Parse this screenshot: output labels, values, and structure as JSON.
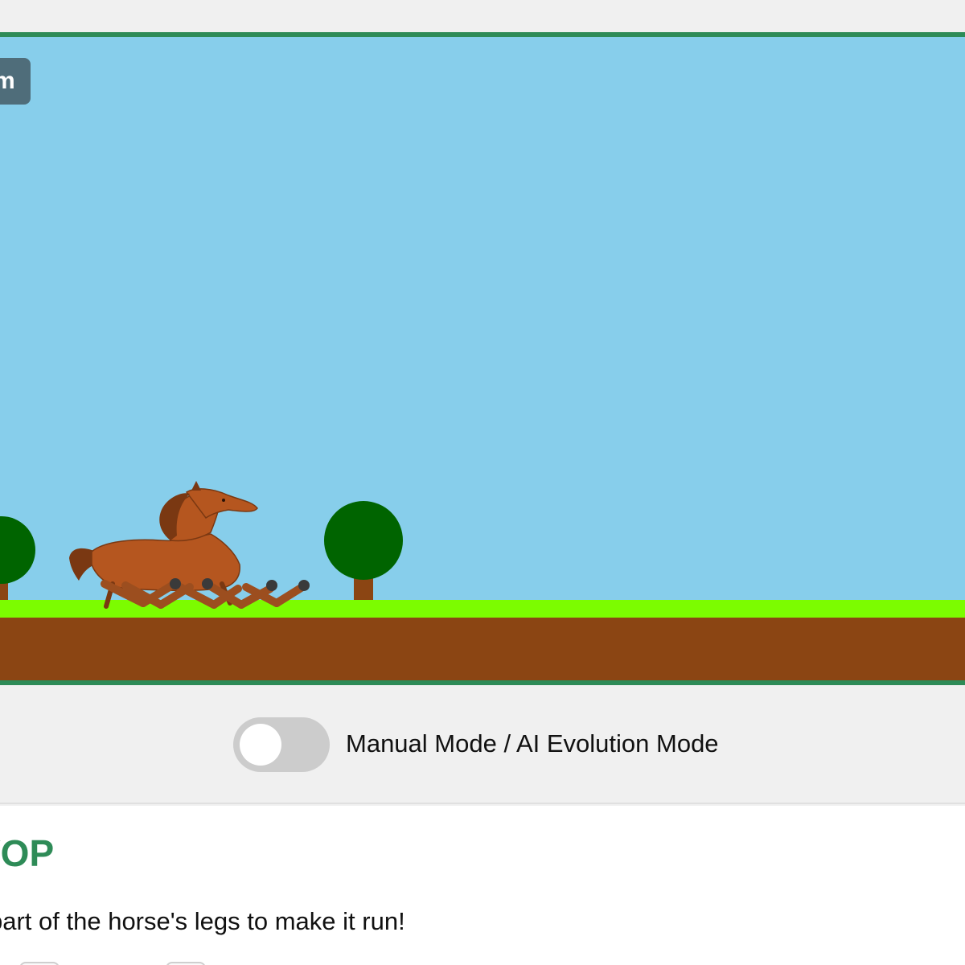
{
  "game": {
    "distance_label": "m",
    "colors": {
      "sky": "#87ceeb",
      "grass": "#7cfc00",
      "dirt": "#8b4513",
      "tree_foliage": "#006400",
      "tree_trunk": "#8b4513",
      "horse_body": "#b5561f",
      "frame_border": "#2e8b57"
    }
  },
  "mode": {
    "toggle_state": "off",
    "label": "Manual Mode / AI Evolution Mode"
  },
  "info": {
    "title": "VOP",
    "instructions": "part of the horse's legs to make it run!"
  }
}
